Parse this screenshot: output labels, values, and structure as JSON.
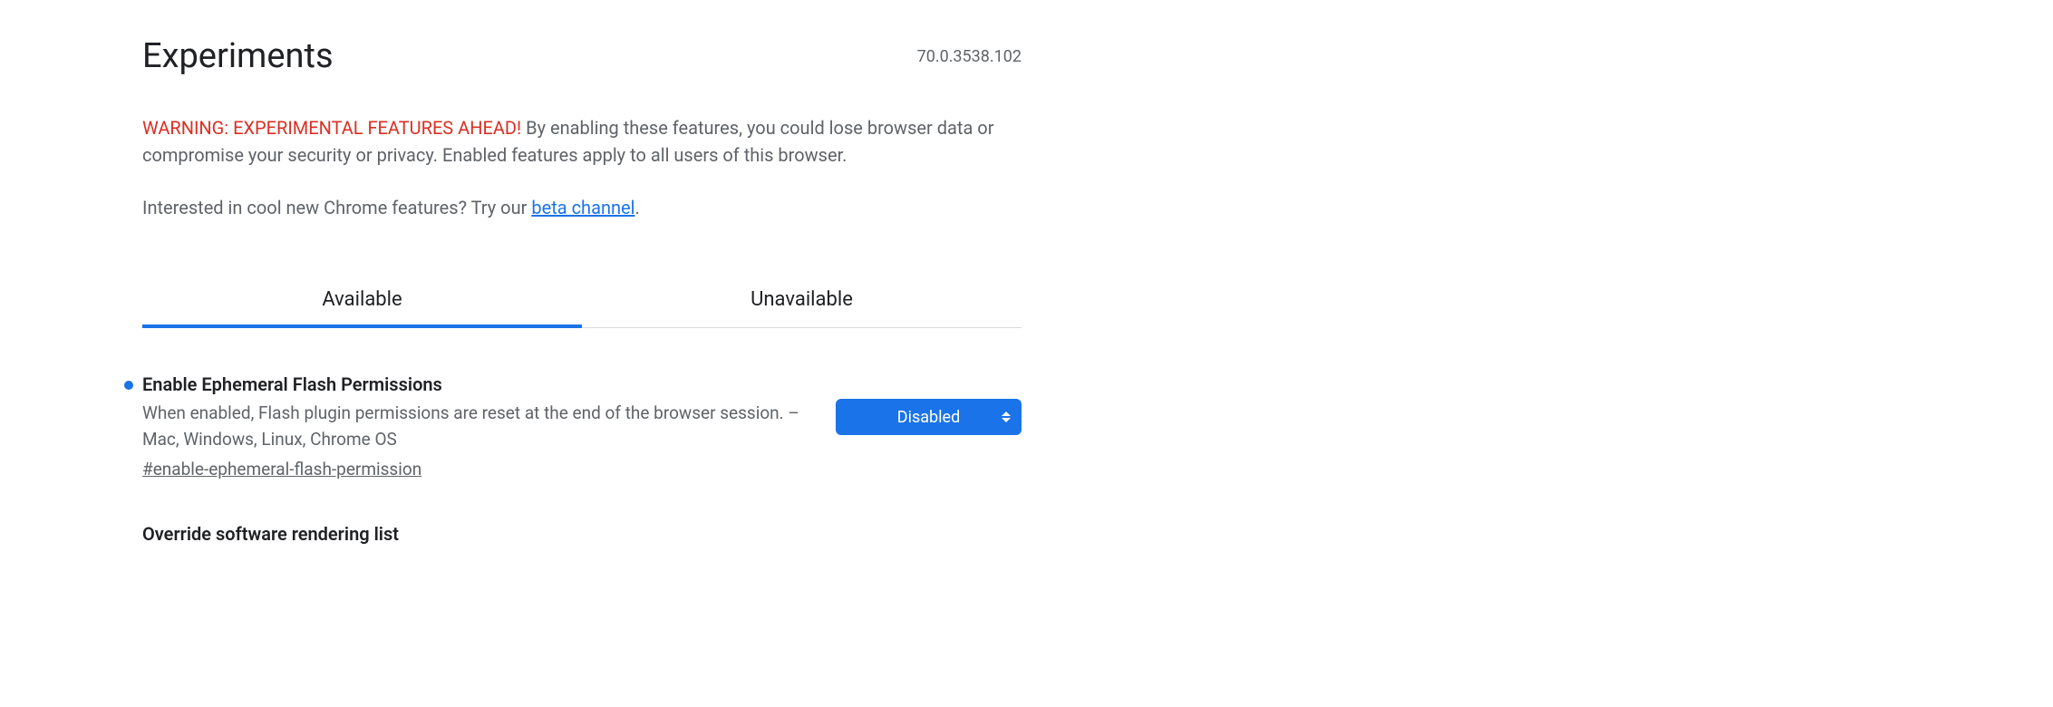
{
  "header": {
    "title": "Experiments",
    "version": "70.0.3538.102"
  },
  "warning": {
    "label": "WARNING: EXPERIMENTAL FEATURES AHEAD!",
    "text": " By enabling these features, you could lose browser data or compromise your security or privacy. Enabled features apply to all users of this browser."
  },
  "beta": {
    "prefix": "Interested in cool new Chrome features? Try our ",
    "link_text": "beta channel",
    "suffix": "."
  },
  "tabs": {
    "available": "Available",
    "unavailable": "Unavailable"
  },
  "flags": [
    {
      "title": "Enable Ephemeral Flash Permissions",
      "description": "When enabled, Flash plugin permissions are reset at the end of the browser session. – Mac, Windows, Linux, Chrome OS",
      "anchor": "#enable-ephemeral-flash-permission",
      "selected": "Disabled",
      "modified": true
    },
    {
      "title": "Override software rendering list",
      "description": "",
      "anchor": "",
      "selected": "",
      "modified": false
    }
  ]
}
